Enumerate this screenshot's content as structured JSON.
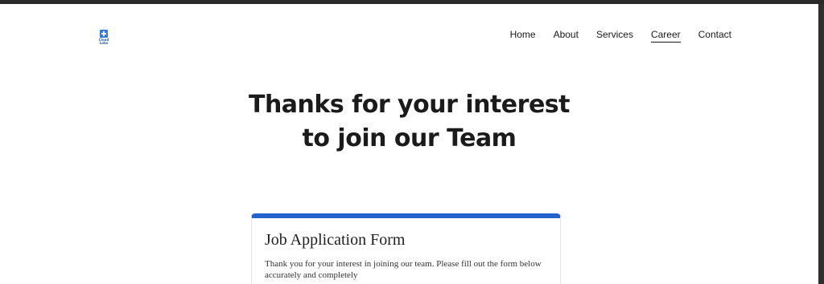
{
  "logo": {
    "text": "Cloud Labs",
    "accent": "#3a7bd5",
    "icon": "plus-square-logo-icon"
  },
  "nav": {
    "items": [
      {
        "label": "Home",
        "active": false
      },
      {
        "label": "About",
        "active": false
      },
      {
        "label": "Services",
        "active": false
      },
      {
        "label": "Career",
        "active": true
      },
      {
        "label": "Contact",
        "active": false
      }
    ]
  },
  "hero": {
    "line1": "Thanks for your interest",
    "line2": "to join our Team"
  },
  "form_card": {
    "title": "Job Application Form",
    "description": "Thank you for your interest in joining our team. Please fill out the form below accurately and completely",
    "accent": "#2563cc"
  }
}
